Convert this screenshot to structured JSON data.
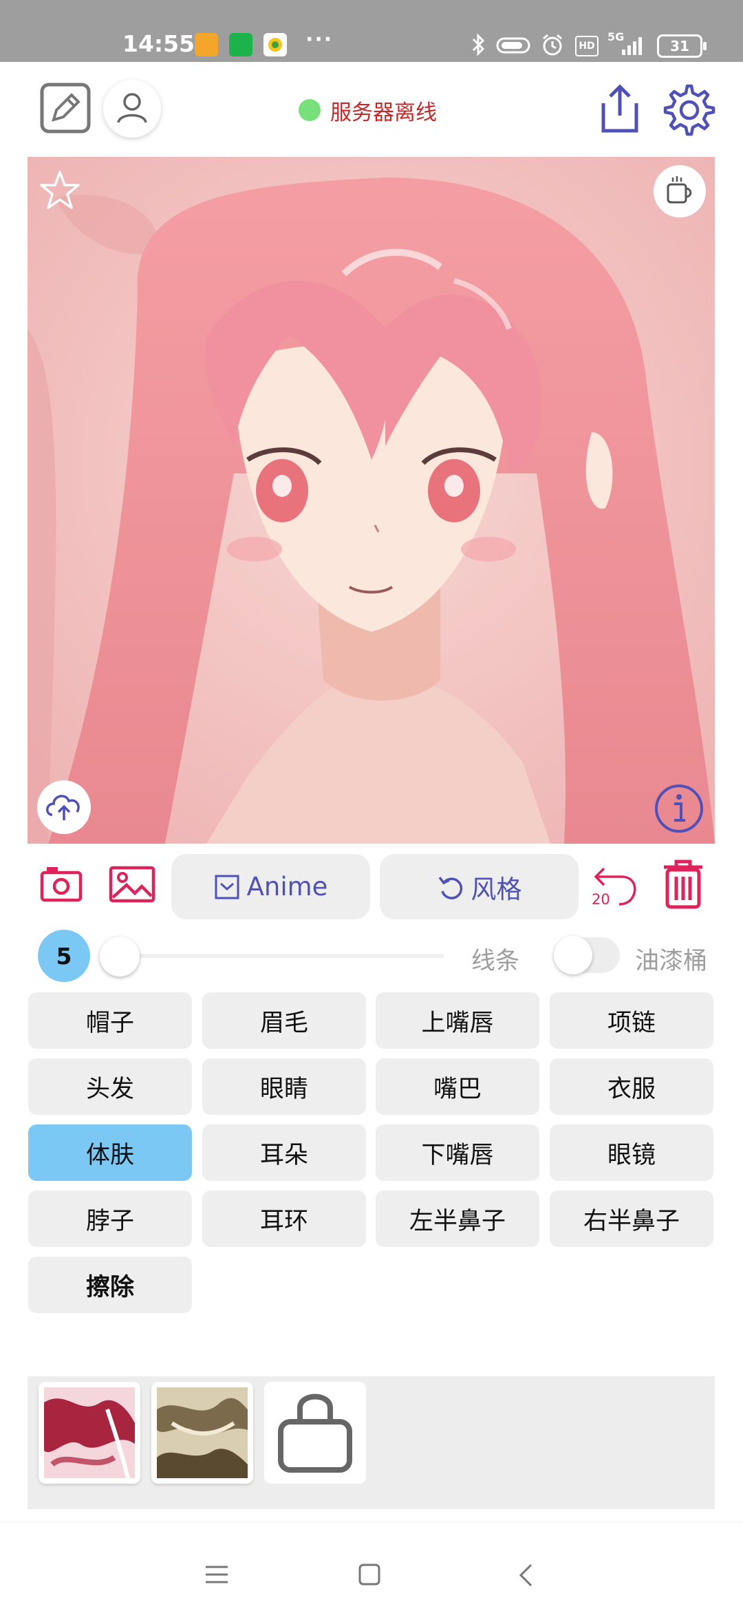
{
  "status_bar": {
    "time": "14:55",
    "dots": "···",
    "battery": "31",
    "network": "5G",
    "hd": "HD"
  },
  "header": {
    "server_status": "服务器离线",
    "server_status_color": "#77e078"
  },
  "toolbar": {
    "anime_label": "Anime",
    "style_label": "风格",
    "undo_count": "20"
  },
  "brush": {
    "size_badge": "5",
    "line_label": "线条",
    "bucket_label": "油漆桶",
    "size_fraction": 0
  },
  "parts": [
    "帽子",
    "眉毛",
    "上嘴唇",
    "项链",
    "头发",
    "眼睛",
    "嘴巴",
    "衣服",
    "体肤",
    "耳朵",
    "下嘴唇",
    "眼镜",
    "脖子",
    "耳环",
    "左半鼻子",
    "右半鼻子",
    "擦除"
  ],
  "selected_part": "体肤",
  "colors": {
    "accent_red": "#e0225a",
    "accent_indigo": "#5051b8",
    "selected_chip": "#7cc8f5"
  }
}
